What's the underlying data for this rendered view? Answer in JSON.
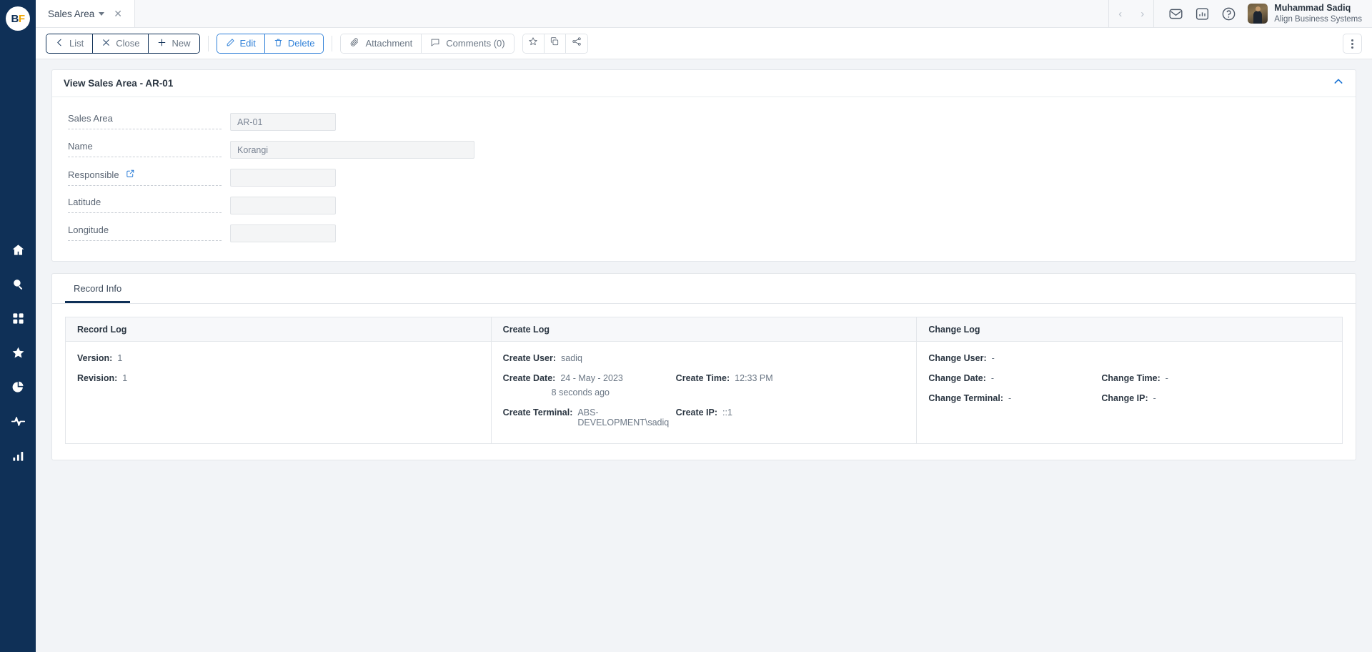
{
  "brand": {
    "logo_b": "B",
    "logo_f": "F",
    "sidebar_color": "#0f3057",
    "accent_blue": "#2f80d8",
    "link_blue": "#1a73d4"
  },
  "sidebar": {
    "items": [
      {
        "name": "home-icon",
        "label": "Home"
      },
      {
        "name": "search-icon",
        "label": "Search"
      },
      {
        "name": "apps-grid-icon",
        "label": "Apps"
      },
      {
        "name": "star-icon",
        "label": "Favorites"
      },
      {
        "name": "pie-chart-icon",
        "label": "Reports"
      },
      {
        "name": "activity-pulse-icon",
        "label": "Activity"
      },
      {
        "name": "bar-chart-icon",
        "label": "Analytics"
      }
    ]
  },
  "topbar": {
    "tab": {
      "label": "Sales Area",
      "close": "✕"
    },
    "nav": {
      "prev": "‹",
      "next": "›"
    },
    "icons": [
      {
        "name": "mail-icon",
        "label": "Messages"
      },
      {
        "name": "bar-chart-icon",
        "label": "Dashboard"
      },
      {
        "name": "help-circle-icon",
        "label": "Help"
      }
    ],
    "user": {
      "name": "Muhammad Sadiq",
      "org": "Align Business Systems"
    }
  },
  "toolbar": {
    "nav_group": [
      {
        "name": "list-button",
        "label": "List",
        "icon": "chevron-left-icon"
      },
      {
        "name": "close-button",
        "label": "Close",
        "icon": "close-x-icon"
      },
      {
        "name": "new-button",
        "label": "New",
        "icon": "plus-icon"
      }
    ],
    "edit_group": [
      {
        "name": "edit-button",
        "label": "Edit",
        "icon": "pencil-icon"
      },
      {
        "name": "delete-button",
        "label": "Delete",
        "icon": "trash-icon"
      }
    ],
    "doc_group": [
      {
        "name": "attachment-button",
        "label": "Attachment",
        "icon": "paperclip-icon"
      },
      {
        "name": "comments-button",
        "label": "Comments (0)",
        "icon": "comment-bubble-icon"
      }
    ],
    "icon_group": [
      {
        "name": "favorite-star-button",
        "icon": "star-icon"
      },
      {
        "name": "duplicate-button",
        "icon": "copy-icon"
      },
      {
        "name": "share-button",
        "icon": "share-icon"
      }
    ],
    "overflow": {
      "name": "more-options-button",
      "label": "More options"
    }
  },
  "panel": {
    "title": "View Sales Area - AR-01",
    "collapse": {
      "name": "collapse-panel-icon",
      "label": "Collapse"
    },
    "fields": [
      {
        "label": "Sales Area",
        "value": "AR-01",
        "placeholder": "",
        "wide": false,
        "has_link": false
      },
      {
        "label": "Name",
        "value": "Korangi",
        "placeholder": "",
        "wide": true,
        "has_link": false
      },
      {
        "label": "Responsible",
        "value": "",
        "placeholder": "",
        "wide": false,
        "has_link": true
      },
      {
        "label": "Latitude",
        "value": "",
        "placeholder": "",
        "wide": false,
        "has_link": false
      },
      {
        "label": "Longitude",
        "value": "",
        "placeholder": "",
        "wide": false,
        "has_link": false
      }
    ]
  },
  "record_info": {
    "tab_label": "Record Info",
    "record_log": {
      "header": "Record Log",
      "rows": [
        {
          "key": "Version:",
          "value": "1"
        },
        {
          "key": "Revision:",
          "value": "1"
        }
      ]
    },
    "create_log": {
      "header": "Create Log",
      "user_key": "Create User:",
      "user_value": "sadiq",
      "date_key": "Create Date:",
      "date_value": "24 - May - 2023",
      "date_relative": "8 seconds ago",
      "time_key": "Create Time:",
      "time_value": "12:33 PM",
      "terminal_key": "Create Terminal:",
      "terminal_value": "ABS-DEVELOPMENT\\sadiq",
      "ip_key": "Create IP:",
      "ip_value": "::1"
    },
    "change_log": {
      "header": "Change Log",
      "user_key": "Change User:",
      "user_value": "-",
      "date_key": "Change Date:",
      "date_value": "-",
      "time_key": "Change Time:",
      "time_value": "-",
      "terminal_key": "Change Terminal:",
      "terminal_value": "-",
      "ip_key": "Change IP:",
      "ip_value": "-"
    }
  }
}
